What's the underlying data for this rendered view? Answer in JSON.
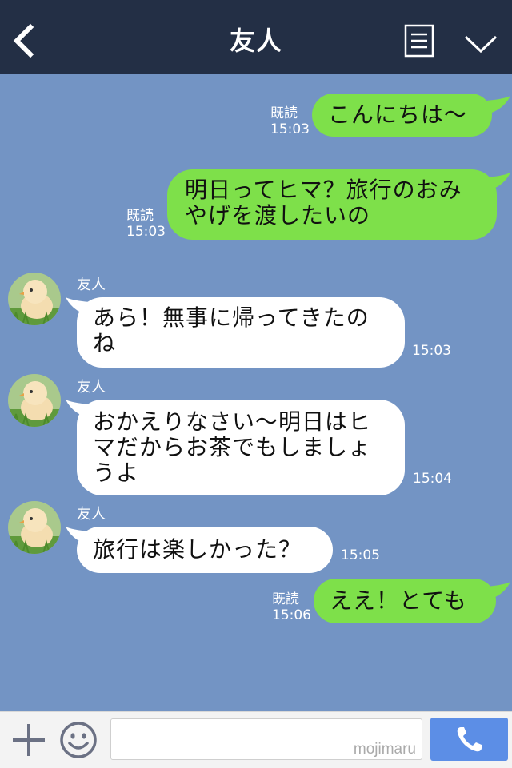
{
  "header": {
    "title": "友人",
    "back_icon": "chevron-left-icon",
    "menu_icon": "document-list-icon",
    "collapse_icon": "chevron-down-icon"
  },
  "messages": [
    {
      "direction": "out",
      "text": "こんにちは〜",
      "read": "既読",
      "time": "15:03"
    },
    {
      "direction": "out",
      "text": "明日ってヒマ？旅行のおみやげを渡したいの",
      "read": "既読",
      "time": "15:03"
    },
    {
      "direction": "in",
      "sender": "友人",
      "text": "あら！無事に帰ってきたのね",
      "time": "15:03"
    },
    {
      "direction": "in",
      "sender": "友人",
      "text": "おかえりなさい〜明日はヒマだからお茶でもしましょうよ",
      "time": "15:04"
    },
    {
      "direction": "in",
      "sender": "友人",
      "text": "旅行は楽しかった？",
      "time": "15:05"
    },
    {
      "direction": "out",
      "text": "ええ！とても",
      "read": "既読",
      "time": "15:06"
    }
  ],
  "input_bar": {
    "plus_icon": "plus-icon",
    "emoji_icon": "smiley-icon",
    "call_icon": "phone-icon",
    "message_value": "",
    "watermark": "mojimaru"
  },
  "colors": {
    "header_bg": "#232f45",
    "chat_bg": "#7394c4",
    "outgoing_bubble": "#7ee04a",
    "incoming_bubble": "#ffffff",
    "call_button": "#5c8ee6"
  }
}
